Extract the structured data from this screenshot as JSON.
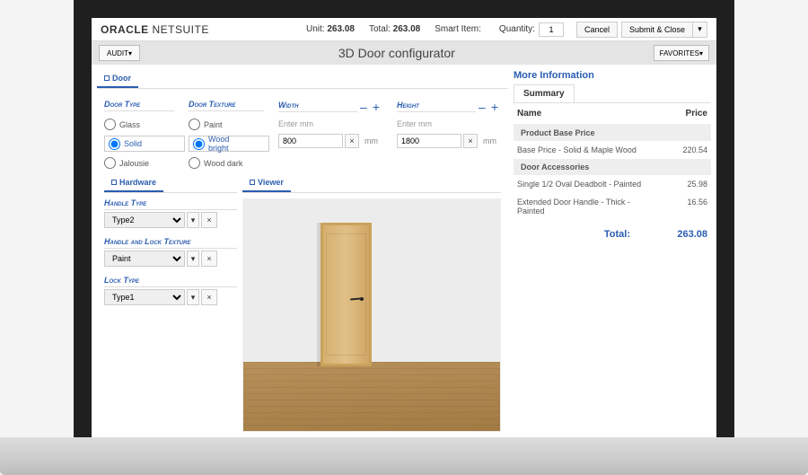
{
  "brand": {
    "part1": "ORACLE",
    "part2": "NETSUITE"
  },
  "header": {
    "unit_label": "Unit:",
    "unit_value": "263.08",
    "total_label": "Total:",
    "total_value": "263.08",
    "smart_item_label": "Smart Item:",
    "quantity_label": "Quantity:",
    "quantity_value": "1",
    "cancel": "Cancel",
    "submit": "Submit & Close"
  },
  "subheader": {
    "audit": "AUDIT▾",
    "title": "3D Door configurator",
    "favorites": "FAVORITES▾"
  },
  "door_tab": {
    "label": "Door"
  },
  "door_type": {
    "label": "Door Type",
    "options": [
      {
        "label": "Glass",
        "selected": false
      },
      {
        "label": "Solid",
        "selected": true
      },
      {
        "label": "Jalousie",
        "selected": false
      }
    ]
  },
  "door_texture": {
    "label": "Door Texture",
    "options": [
      {
        "label": "Paint",
        "selected": false
      },
      {
        "label": "Wood bright",
        "selected": true
      },
      {
        "label": "Wood dark",
        "selected": false
      }
    ]
  },
  "width": {
    "label": "Width",
    "hint": "Enter mm",
    "value": "800",
    "unit": "mm"
  },
  "height": {
    "label": "Height",
    "hint": "Enter mm",
    "value": "1800",
    "unit": "mm"
  },
  "hardware_tab": {
    "label": "Hardware"
  },
  "viewer_tab": {
    "label": "Viewer"
  },
  "handle_type": {
    "label": "Handle Type",
    "value": "Type2"
  },
  "handle_lock_texture": {
    "label": "Handle and Lock Texture",
    "value": "Paint"
  },
  "lock_type": {
    "label": "Lock Type",
    "value": "Type1"
  },
  "more_info": {
    "title": "More Information",
    "summary_tab": "Summary",
    "name_col": "Name",
    "price_col": "Price",
    "section_base": "Product Base Price",
    "section_acc": "Door Accessories",
    "rows_base": [
      {
        "name": "Base Price - Solid & Maple Wood",
        "price": "220.54"
      }
    ],
    "rows_acc": [
      {
        "name": "Single 1/2 Oval Deadbolt - Painted",
        "price": "25.98"
      },
      {
        "name": "Extended Door Handle - Thick  - Painted",
        "price": "16.56"
      }
    ],
    "total_label": "Total:",
    "total_value": "263.08"
  },
  "icons": {
    "clear": "×",
    "caret": "▾",
    "minus": "–",
    "plus": "+"
  }
}
